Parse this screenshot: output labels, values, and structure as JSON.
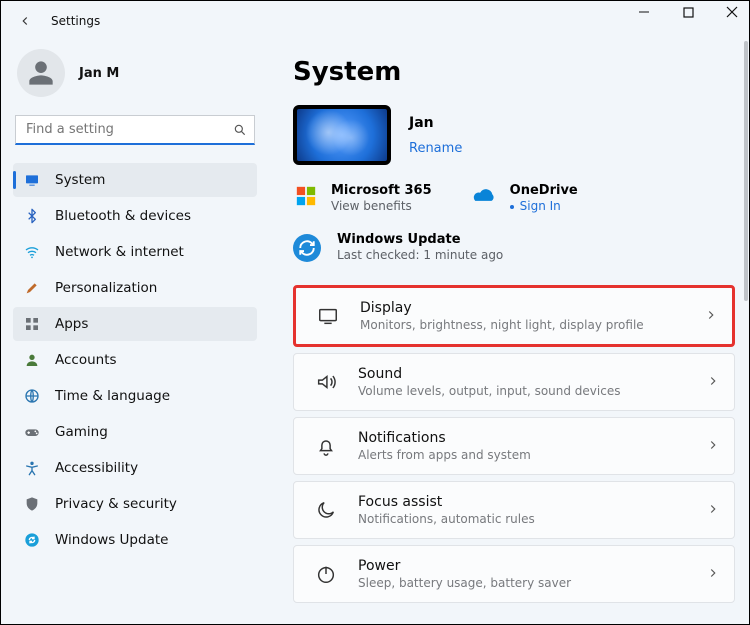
{
  "app": {
    "title": "Settings"
  },
  "profile": {
    "name": "Jan M"
  },
  "search": {
    "placeholder": "Find a setting"
  },
  "nav": {
    "items": [
      {
        "label": "System",
        "icon": "system",
        "color": "#1e6fd9",
        "selected": true
      },
      {
        "label": "Bluetooth & devices",
        "icon": "bluetooth",
        "color": "#2a63c0"
      },
      {
        "label": "Network & internet",
        "icon": "wifi",
        "color": "#1a9fd9"
      },
      {
        "label": "Personalization",
        "icon": "brush",
        "color": "#c06a2a"
      },
      {
        "label": "Apps",
        "icon": "apps",
        "color": "#6b7076",
        "hover": true
      },
      {
        "label": "Accounts",
        "icon": "person",
        "color": "#4a7a3a"
      },
      {
        "label": "Time & language",
        "icon": "globe",
        "color": "#2a75b0"
      },
      {
        "label": "Gaming",
        "icon": "gamepad",
        "color": "#6b7076"
      },
      {
        "label": "Accessibility",
        "icon": "accessibility",
        "color": "#2a75b0"
      },
      {
        "label": "Privacy & security",
        "icon": "shield",
        "color": "#6b7076"
      },
      {
        "label": "Windows Update",
        "icon": "update",
        "color": "#1a9fd9"
      }
    ]
  },
  "main": {
    "title": "System",
    "pc": {
      "name": "Jan",
      "rename_label": "Rename"
    },
    "m365": {
      "title": "Microsoft 365",
      "sub": "View benefits"
    },
    "onedrive": {
      "title": "OneDrive",
      "sub": "Sign In"
    },
    "wu": {
      "title": "Windows Update",
      "sub": "Last checked: 1 minute ago"
    },
    "cards": [
      {
        "title": "Display",
        "sub": "Monitors, brightness, night light, display profile",
        "icon": "display",
        "highlight": true
      },
      {
        "title": "Sound",
        "sub": "Volume levels, output, input, sound devices",
        "icon": "sound"
      },
      {
        "title": "Notifications",
        "sub": "Alerts from apps and system",
        "icon": "bell"
      },
      {
        "title": "Focus assist",
        "sub": "Notifications, automatic rules",
        "icon": "moon"
      },
      {
        "title": "Power",
        "sub": "Sleep, battery usage, battery saver",
        "icon": "power"
      }
    ]
  }
}
